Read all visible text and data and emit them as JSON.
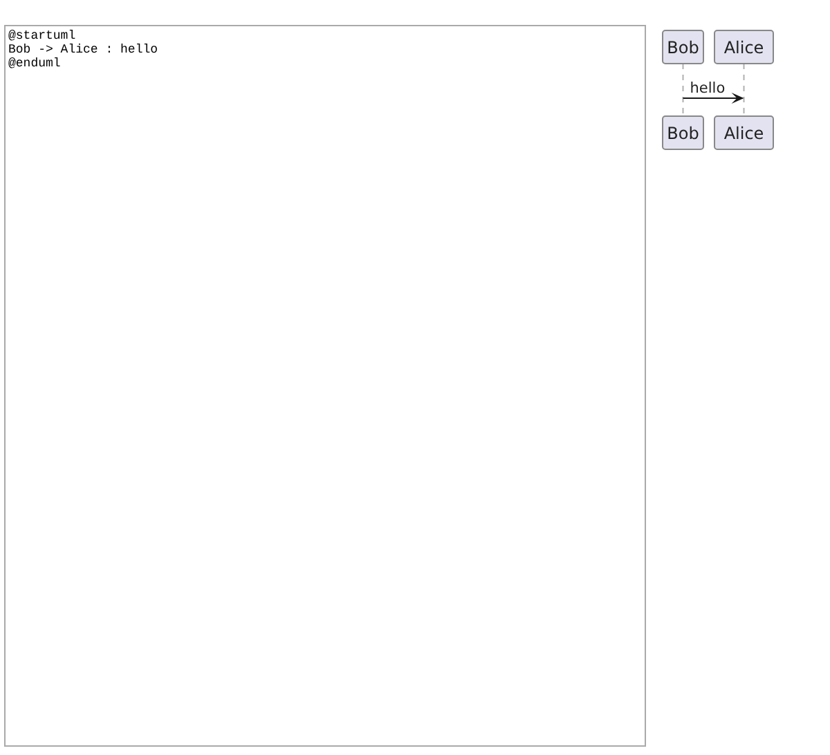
{
  "editor": {
    "lines": [
      "@startuml",
      "Bob -> Alice : hello",
      "@enduml"
    ]
  },
  "diagram": {
    "participants": [
      "Bob",
      "Alice"
    ],
    "messages": [
      {
        "label": "hello"
      }
    ],
    "bottom_participants": [
      "Bob",
      "Alice"
    ]
  }
}
